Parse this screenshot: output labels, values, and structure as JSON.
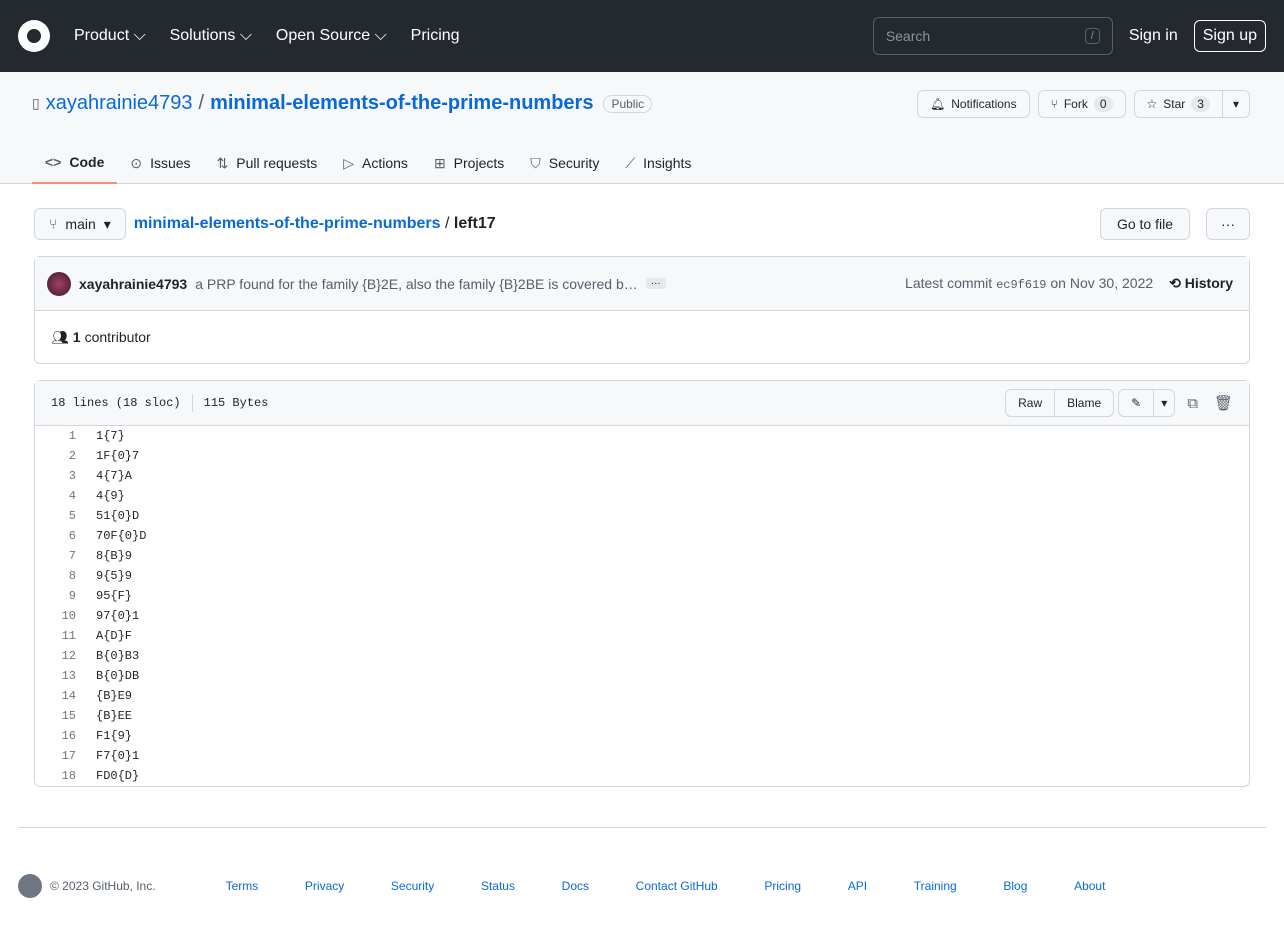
{
  "header": {
    "nav": [
      "Product",
      "Solutions",
      "Open Source",
      "Pricing"
    ],
    "search_placeholder": "Search",
    "search_key": "/",
    "sign_in": "Sign in",
    "sign_up": "Sign up"
  },
  "repo": {
    "owner": "xayahrainie4793",
    "name": "minimal-elements-of-the-prime-numbers",
    "visibility": "Public",
    "notifications": "Notifications",
    "fork": "Fork",
    "fork_count": "0",
    "star": "Star",
    "star_count": "3"
  },
  "tabs": [
    "Code",
    "Issues",
    "Pull requests",
    "Actions",
    "Projects",
    "Security",
    "Insights"
  ],
  "file": {
    "branch": "main",
    "repo_link": "minimal-elements-of-the-prime-numbers",
    "sep": "/",
    "filename": "left17",
    "go_to_file": "Go to file",
    "more": "···"
  },
  "commit": {
    "author": "xayahrainie4793",
    "message": "a PRP found for the family {B}2E, also the family {B}2BE is covered b…",
    "ellipsis": "···",
    "latest": "Latest commit",
    "sha": "ec9f619",
    "date": "on Nov 30, 2022",
    "history": "History"
  },
  "contributors": {
    "count": "1",
    "label": "contributor"
  },
  "fileinfo": {
    "lines": "18 lines (18 sloc)",
    "size": "115 Bytes",
    "raw": "Raw",
    "blame": "Blame"
  },
  "lines": [
    "1{7}",
    "1F{0}7",
    "4{7}A",
    "4{9}",
    "51{0}D",
    "70F{0}D",
    "8{B}9",
    "9{5}9",
    "95{F}",
    "97{0}1",
    "A{D}F",
    "B{0}B3",
    "B{0}DB",
    "{B}E9",
    "{B}EE",
    "F1{9}",
    "F7{0}1",
    "FD0{D}"
  ],
  "footer": {
    "copyright": "© 2023 GitHub, Inc.",
    "links": [
      "Terms",
      "Privacy",
      "Security",
      "Status",
      "Docs",
      "Contact GitHub",
      "Pricing",
      "API",
      "Training",
      "Blog",
      "About"
    ]
  }
}
